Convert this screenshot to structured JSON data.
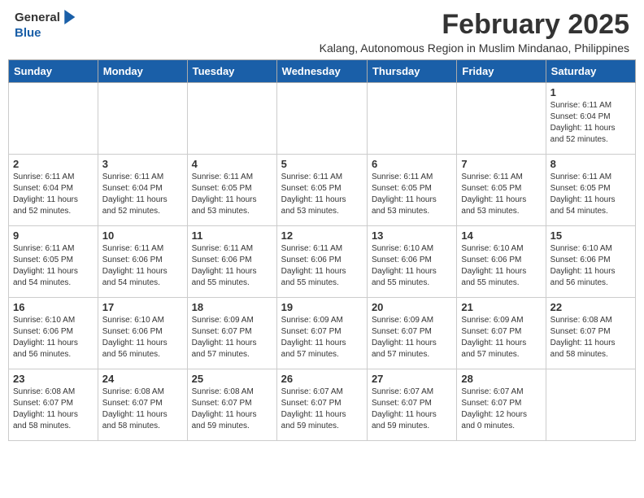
{
  "header": {
    "logo_line1": "General",
    "logo_line2": "Blue",
    "month_year": "February 2025",
    "subtitle": "Kalang, Autonomous Region in Muslim Mindanao, Philippines"
  },
  "days_of_week": [
    "Sunday",
    "Monday",
    "Tuesday",
    "Wednesday",
    "Thursday",
    "Friday",
    "Saturday"
  ],
  "weeks": [
    [
      {
        "day": "",
        "info": ""
      },
      {
        "day": "",
        "info": ""
      },
      {
        "day": "",
        "info": ""
      },
      {
        "day": "",
        "info": ""
      },
      {
        "day": "",
        "info": ""
      },
      {
        "day": "",
        "info": ""
      },
      {
        "day": "1",
        "info": "Sunrise: 6:11 AM\nSunset: 6:04 PM\nDaylight: 11 hours\nand 52 minutes."
      }
    ],
    [
      {
        "day": "2",
        "info": "Sunrise: 6:11 AM\nSunset: 6:04 PM\nDaylight: 11 hours\nand 52 minutes."
      },
      {
        "day": "3",
        "info": "Sunrise: 6:11 AM\nSunset: 6:04 PM\nDaylight: 11 hours\nand 52 minutes."
      },
      {
        "day": "4",
        "info": "Sunrise: 6:11 AM\nSunset: 6:05 PM\nDaylight: 11 hours\nand 53 minutes."
      },
      {
        "day": "5",
        "info": "Sunrise: 6:11 AM\nSunset: 6:05 PM\nDaylight: 11 hours\nand 53 minutes."
      },
      {
        "day": "6",
        "info": "Sunrise: 6:11 AM\nSunset: 6:05 PM\nDaylight: 11 hours\nand 53 minutes."
      },
      {
        "day": "7",
        "info": "Sunrise: 6:11 AM\nSunset: 6:05 PM\nDaylight: 11 hours\nand 53 minutes."
      },
      {
        "day": "8",
        "info": "Sunrise: 6:11 AM\nSunset: 6:05 PM\nDaylight: 11 hours\nand 54 minutes."
      }
    ],
    [
      {
        "day": "9",
        "info": "Sunrise: 6:11 AM\nSunset: 6:05 PM\nDaylight: 11 hours\nand 54 minutes."
      },
      {
        "day": "10",
        "info": "Sunrise: 6:11 AM\nSunset: 6:06 PM\nDaylight: 11 hours\nand 54 minutes."
      },
      {
        "day": "11",
        "info": "Sunrise: 6:11 AM\nSunset: 6:06 PM\nDaylight: 11 hours\nand 55 minutes."
      },
      {
        "day": "12",
        "info": "Sunrise: 6:11 AM\nSunset: 6:06 PM\nDaylight: 11 hours\nand 55 minutes."
      },
      {
        "day": "13",
        "info": "Sunrise: 6:10 AM\nSunset: 6:06 PM\nDaylight: 11 hours\nand 55 minutes."
      },
      {
        "day": "14",
        "info": "Sunrise: 6:10 AM\nSunset: 6:06 PM\nDaylight: 11 hours\nand 55 minutes."
      },
      {
        "day": "15",
        "info": "Sunrise: 6:10 AM\nSunset: 6:06 PM\nDaylight: 11 hours\nand 56 minutes."
      }
    ],
    [
      {
        "day": "16",
        "info": "Sunrise: 6:10 AM\nSunset: 6:06 PM\nDaylight: 11 hours\nand 56 minutes."
      },
      {
        "day": "17",
        "info": "Sunrise: 6:10 AM\nSunset: 6:06 PM\nDaylight: 11 hours\nand 56 minutes."
      },
      {
        "day": "18",
        "info": "Sunrise: 6:09 AM\nSunset: 6:07 PM\nDaylight: 11 hours\nand 57 minutes."
      },
      {
        "day": "19",
        "info": "Sunrise: 6:09 AM\nSunset: 6:07 PM\nDaylight: 11 hours\nand 57 minutes."
      },
      {
        "day": "20",
        "info": "Sunrise: 6:09 AM\nSunset: 6:07 PM\nDaylight: 11 hours\nand 57 minutes."
      },
      {
        "day": "21",
        "info": "Sunrise: 6:09 AM\nSunset: 6:07 PM\nDaylight: 11 hours\nand 57 minutes."
      },
      {
        "day": "22",
        "info": "Sunrise: 6:08 AM\nSunset: 6:07 PM\nDaylight: 11 hours\nand 58 minutes."
      }
    ],
    [
      {
        "day": "23",
        "info": "Sunrise: 6:08 AM\nSunset: 6:07 PM\nDaylight: 11 hours\nand 58 minutes."
      },
      {
        "day": "24",
        "info": "Sunrise: 6:08 AM\nSunset: 6:07 PM\nDaylight: 11 hours\nand 58 minutes."
      },
      {
        "day": "25",
        "info": "Sunrise: 6:08 AM\nSunset: 6:07 PM\nDaylight: 11 hours\nand 59 minutes."
      },
      {
        "day": "26",
        "info": "Sunrise: 6:07 AM\nSunset: 6:07 PM\nDaylight: 11 hours\nand 59 minutes."
      },
      {
        "day": "27",
        "info": "Sunrise: 6:07 AM\nSunset: 6:07 PM\nDaylight: 11 hours\nand 59 minutes."
      },
      {
        "day": "28",
        "info": "Sunrise: 6:07 AM\nSunset: 6:07 PM\nDaylight: 12 hours\nand 0 minutes."
      },
      {
        "day": "",
        "info": ""
      }
    ]
  ]
}
